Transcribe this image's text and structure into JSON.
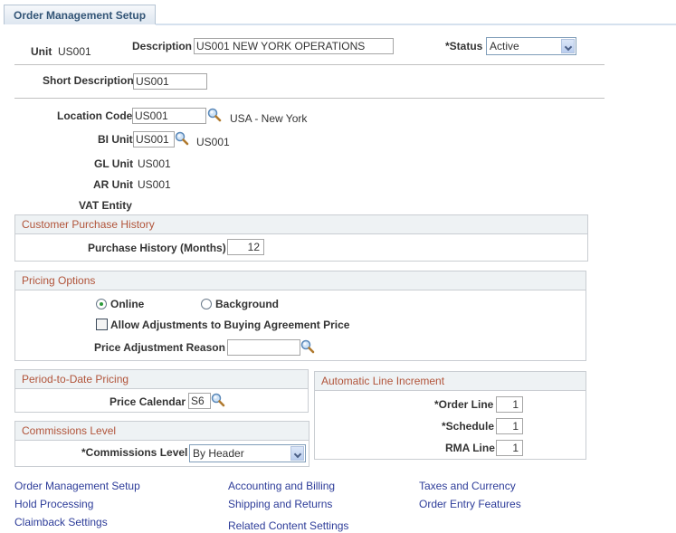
{
  "tab": {
    "label": "Order Management Setup"
  },
  "header": {
    "unit_label": "Unit",
    "unit_value": "US001",
    "description_label": "Description",
    "description_value": "US001 NEW YORK OPERATIONS",
    "status_label": "*Status",
    "status_value": "Active",
    "short_description_label": "Short Description",
    "short_description_value": "US001"
  },
  "details": {
    "location_code_label": "Location Code",
    "location_code_value": "US001",
    "location_code_desc": "USA - New York",
    "bi_unit_label": "BI Unit",
    "bi_unit_value": "US001",
    "bi_unit_desc": "US001",
    "gl_unit_label": "GL Unit",
    "gl_unit_value": "US001",
    "ar_unit_label": "AR Unit",
    "ar_unit_value": "US001",
    "vat_entity_label": "VAT Entity"
  },
  "customer_purchase_history": {
    "title": "Customer Purchase History",
    "months_label": "Purchase History (Months)",
    "months_value": "12"
  },
  "pricing_options": {
    "title": "Pricing Options",
    "radio_online": "Online",
    "radio_background": "Background",
    "selected": "Online",
    "allow_adjustments_label": "Allow Adjustments to Buying Agreement Price",
    "allow_adjustments_checked": false,
    "price_adjustment_reason_label": "Price Adjustment Reason",
    "price_adjustment_reason_value": ""
  },
  "period_to_date_pricing": {
    "title": "Period-to-Date Pricing",
    "price_calendar_label": "Price Calendar",
    "price_calendar_value": "S6"
  },
  "commissions_level": {
    "title": "Commissions Level",
    "label": "*Commissions Level",
    "value": "By Header"
  },
  "automatic_line_increment": {
    "title": "Automatic Line Increment",
    "order_line_label": "*Order Line",
    "order_line_value": "1",
    "schedule_label": "*Schedule",
    "schedule_value": "1",
    "rma_line_label": "RMA Line",
    "rma_line_value": "1"
  },
  "links": {
    "col1": [
      "Order Management Setup",
      "Hold Processing",
      "Claimback Settings"
    ],
    "col2": [
      "Accounting and Billing",
      "Shipping and Returns",
      "Related Content Settings"
    ],
    "col3": [
      "Taxes and Currency",
      "Order Entry Features"
    ]
  },
  "colors": {
    "group_title": "#b1543a",
    "link": "#2d3c99",
    "tab_text": "#335577"
  }
}
